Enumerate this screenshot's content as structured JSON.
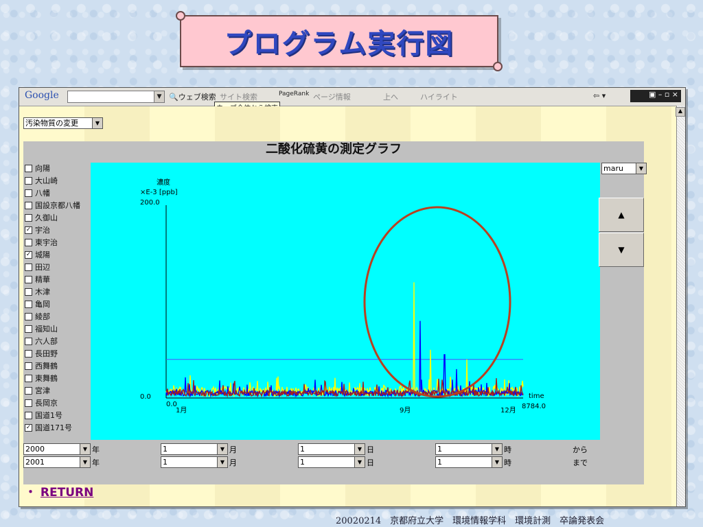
{
  "slide_title": "プログラム実行図",
  "toolbar": {
    "google_label": "Google",
    "web_search": "ウェブ検索",
    "site_search": "サイト検索",
    "pagerank": "PageRank",
    "page_info": "ページ情報",
    "up": "上へ",
    "highlight": "ハイライト",
    "tooltip": "ウェブ全体から検索"
  },
  "pollutant_select": "汚染物質の変更",
  "graph_title": "二酸化硫黄の測定グラフ",
  "stations": [
    {
      "name": "向陽",
      "checked": false
    },
    {
      "name": "大山崎",
      "checked": false
    },
    {
      "name": "八幡",
      "checked": false
    },
    {
      "name": "国設京都八幡",
      "checked": false
    },
    {
      "name": "久御山",
      "checked": false
    },
    {
      "name": "宇治",
      "checked": true
    },
    {
      "name": "東宇治",
      "checked": false
    },
    {
      "name": "城陽",
      "checked": true
    },
    {
      "name": "田辺",
      "checked": false
    },
    {
      "name": "精華",
      "checked": false
    },
    {
      "name": "木津",
      "checked": false
    },
    {
      "name": "亀岡",
      "checked": false
    },
    {
      "name": "綾部",
      "checked": false
    },
    {
      "name": "福知山",
      "checked": false
    },
    {
      "name": "六人部",
      "checked": false
    },
    {
      "name": "長田野",
      "checked": false
    },
    {
      "name": "西舞鶴",
      "checked": false
    },
    {
      "name": "東舞鶴",
      "checked": false
    },
    {
      "name": "宮津",
      "checked": false
    },
    {
      "name": "長岡京",
      "checked": false
    },
    {
      "name": "国道1号",
      "checked": false
    },
    {
      "name": "国道171号",
      "checked": true
    }
  ],
  "marker_select": "maru",
  "up_button": "▲",
  "down_button": "▼",
  "chart_data": {
    "type": "line",
    "ylabel_line1": "濃度",
    "ylabel_line2": "×E-3 [ppb]",
    "ymax_label": "200.0",
    "ymin_label": "0.0",
    "xmin_label": "0.0",
    "xmax_label": "8784.0",
    "xlabel": "time",
    "xtick_labels": [
      "1月",
      "9月",
      "12月"
    ],
    "ylim": [
      0,
      200
    ],
    "xlim": [
      0,
      8784
    ],
    "threshold": 40,
    "series": [
      {
        "color": "#ffff00"
      },
      {
        "color": "#0000ff"
      },
      {
        "color": "#a02020"
      }
    ],
    "annotation": "circle"
  },
  "date_rows": [
    {
      "year": "2000",
      "month": "1",
      "day": "1",
      "hour": "1",
      "suffix": "から"
    },
    {
      "year": "2001",
      "month": "1",
      "day": "1",
      "hour": "1",
      "suffix": "まで"
    }
  ],
  "date_units": {
    "year": "年",
    "month": "月",
    "day": "日",
    "hour": "時"
  },
  "return_label": "RETURN",
  "return_bullet": "・",
  "footer": "20020214　京都府立大学　環境情報学科　環境計測　卒論発表会"
}
